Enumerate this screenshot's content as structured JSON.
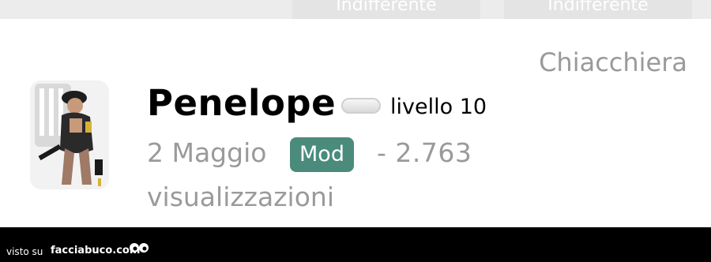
{
  "top_tabs": [
    {
      "label": "Indifferente"
    },
    {
      "label": "Indifferente"
    }
  ],
  "post": {
    "category": "Chiacchiera",
    "username": "Penelope",
    "level": "livello 10",
    "date": "2 Maggio",
    "badge": "Mod",
    "views": "- 2.763",
    "views_label": "visualizzazioni"
  },
  "footer": {
    "visto_su": "visto su",
    "brand": "facciabuco.com"
  },
  "colors": {
    "badge_bg": "#4a8b7c",
    "muted_text": "#9a9a9a",
    "footer_bg": "#000000"
  }
}
